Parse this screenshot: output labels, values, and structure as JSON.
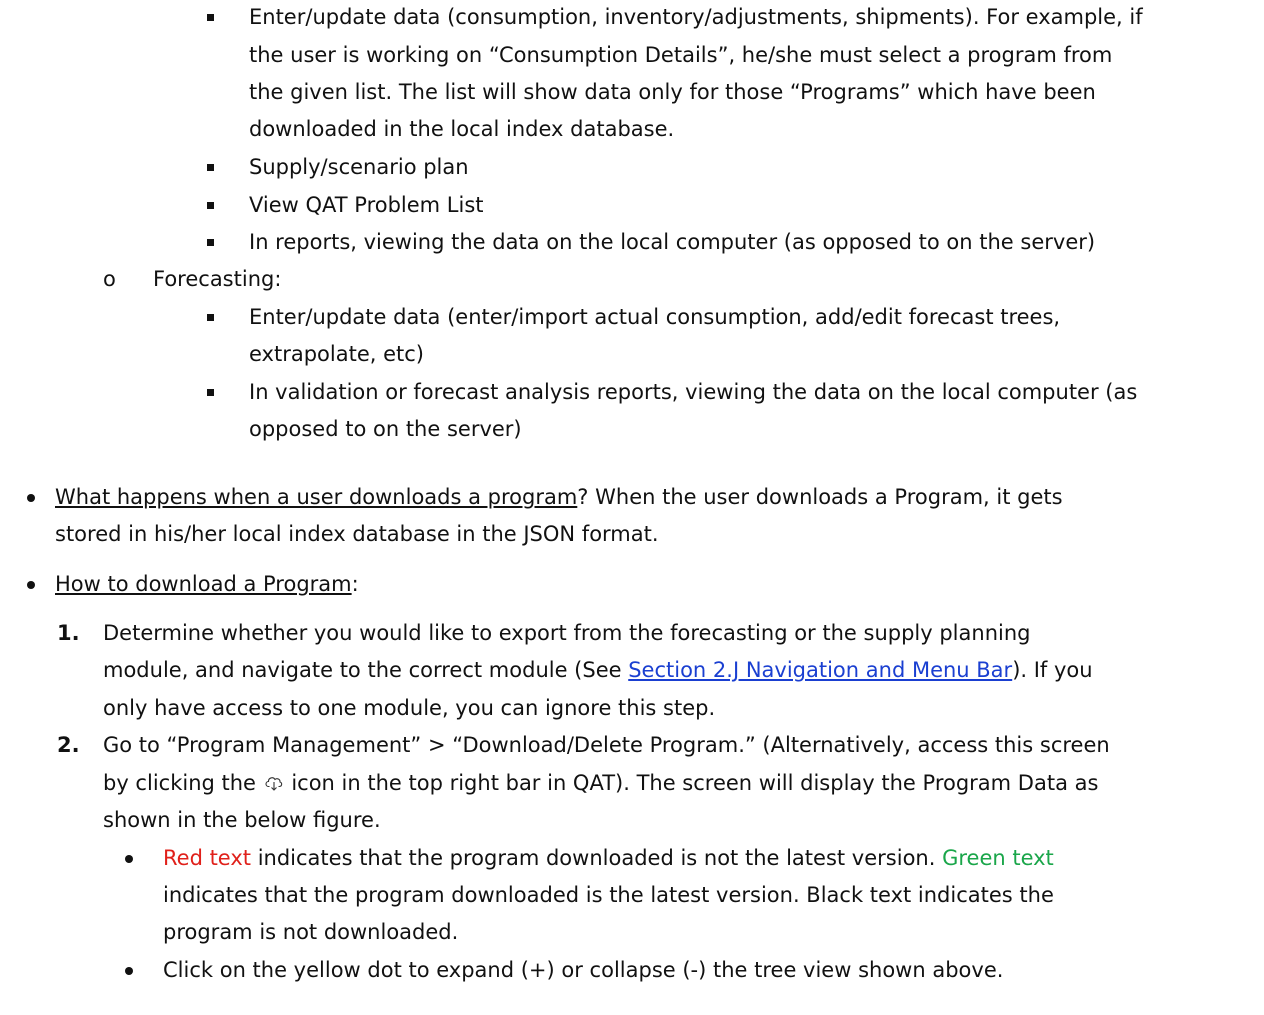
{
  "supply_items": [
    {
      "lines": [
        "Enter/update data (consumption, inventory/adjustments, shipments). For example, if",
        "the user is working on “Consumption Details”, he/she must select a program from",
        "the given list. The list will show data only for those “Programs” which have been",
        "downloaded in the local index database."
      ]
    },
    {
      "lines": [
        "Supply/scenario plan"
      ]
    },
    {
      "lines": [
        "View QAT Problem List"
      ]
    },
    {
      "lines": [
        "In reports, viewing the data on the local computer (as opposed to on the server)"
      ]
    }
  ],
  "forecasting_label": "Forecasting:",
  "forecasting_items": [
    {
      "lines": [
        "Enter/update data (enter/import actual consumption, add/edit forecast trees,",
        "extrapolate, etc)"
      ]
    },
    {
      "lines": [
        "In validation or forecast analysis reports, viewing the data on the local computer (as",
        "opposed to on the server)"
      ]
    }
  ],
  "what_happens": {
    "heading": "What happens when a user downloads a program",
    "rest_line1": "? When the user downloads a Program, it gets",
    "line2": "stored in his/her local index database in the JSON format."
  },
  "how_to": {
    "heading": "How to download a Program",
    "colon": ":"
  },
  "steps": {
    "step1": {
      "number": "1.",
      "line1": "Determine whether you would like to export from the forecasting or the supply planning",
      "line2_pre": "module, and navigate to the correct module (See ",
      "link_text": "Section 2.J Navigation and Menu Bar",
      "line2_post": "). If you",
      "line3": "only have access to one module, you can ignore this step."
    },
    "step2": {
      "number": "2.",
      "line1": "Go to “Program Management” > “Download/Delete Program.” (Alternatively, access this screen",
      "line2_pre": "by clicking the ",
      "line2_post": " icon in the top right bar in QAT). The screen will display the Program Data as",
      "line3": "shown in the below figure."
    }
  },
  "sub_bullets": {
    "b1": {
      "red_text": "Red text",
      "mid": " indicates that the program downloaded is not the latest version. ",
      "green_text": "Green text",
      "line2": "indicates that the program downloaded is the latest version. Black text indicates the",
      "line3": "program is not downloaded."
    },
    "b2": "Click on the yellow dot to expand (+) or collapse (-) the tree view shown above."
  },
  "icons": {
    "square_bullet": "square-bullet-icon",
    "circle_bullet": "circle-bullet-icon",
    "cloud": "cloud-download-icon"
  },
  "colors": {
    "link": "#1a3fd1",
    "red": "#e0201a",
    "green": "#1aa64a"
  }
}
